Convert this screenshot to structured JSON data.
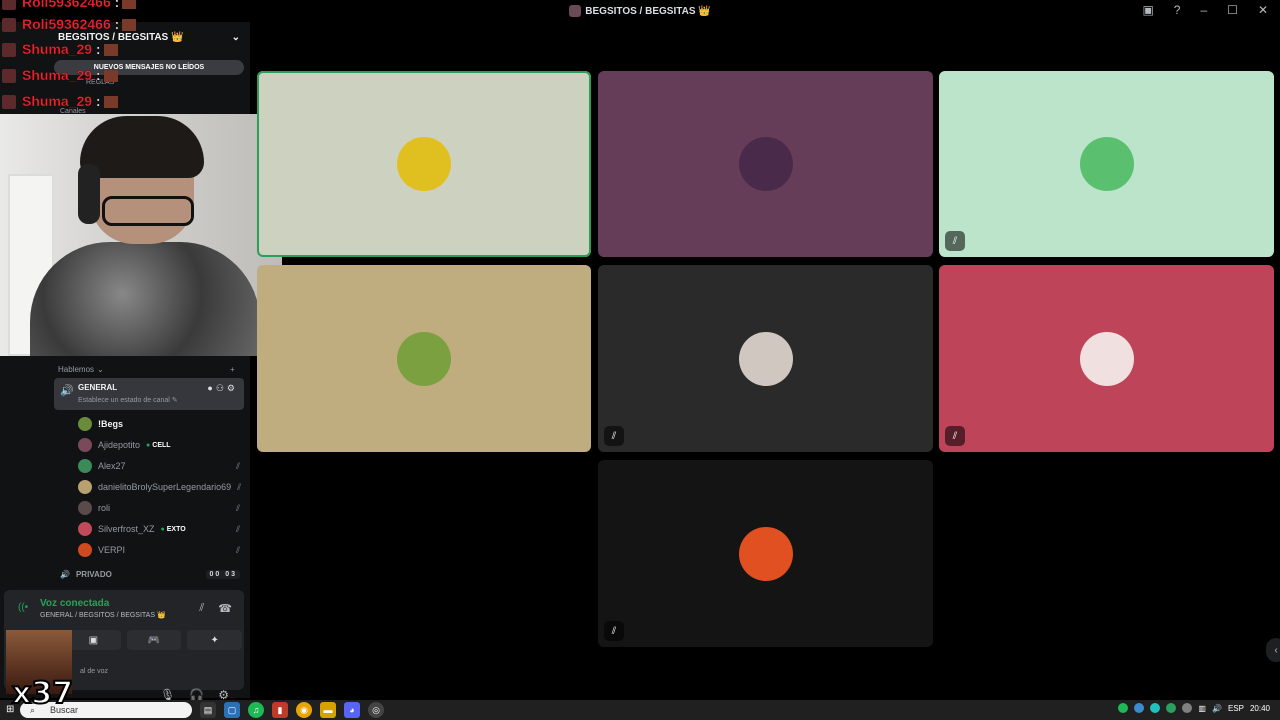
{
  "window": {
    "title": "BEGSITOS / BEGSITAS 👑"
  },
  "server": {
    "name": "BEGSITOS / BEGSITAS 👑",
    "unread_pill": "NUEVOS MENSAJES NO LEÍDOS",
    "channel_fragment": "REGLAS",
    "category_top": "Canales"
  },
  "stream_chat": [
    {
      "user": "Roli59362466",
      "sep": " :"
    },
    {
      "user": "Roli59362466",
      "sep": " :"
    },
    {
      "user": "Shuma_29",
      "sep": " :"
    },
    {
      "user": "Shuma_29",
      "sep": " :"
    },
    {
      "user": "Shuma_29",
      "sep": " :"
    }
  ],
  "category": {
    "name": "Hablemos"
  },
  "voice_channel": {
    "name": "GENERAL",
    "status_placeholder": "Establece un estado de canal"
  },
  "members": [
    {
      "name": "!Begs",
      "active": true,
      "badge": "",
      "color": "#6a8c3a",
      "muted": false
    },
    {
      "name": "Ajidepotito",
      "active": false,
      "badge": "CELL",
      "color": "#7a4a5a",
      "muted": false
    },
    {
      "name": "Alex27",
      "active": false,
      "badge": "",
      "color": "#3a8a5a",
      "muted": true
    },
    {
      "name": "danielitoBrolySuperLegendario69",
      "active": false,
      "badge": "",
      "color": "#b8a070",
      "muted": true
    },
    {
      "name": "roli",
      "active": false,
      "badge": "",
      "color": "#5a4a4a",
      "muted": true
    },
    {
      "name": "Silverfrost_XZ",
      "active": false,
      "badge": "EXTO",
      "color": "#c04a5a",
      "muted": true
    },
    {
      "name": "VERPI",
      "active": false,
      "badge": "",
      "color": "#d04a20",
      "muted": true
    }
  ],
  "private_channel": {
    "name": "PRIVADO",
    "count": "00 03"
  },
  "voice_panel": {
    "status": "Voz conectada",
    "location": "GENERAL / BEGSITOS / BEGSITAS 👑",
    "bottom_text": "al de voz"
  },
  "overlay": {
    "emote_count": "x37"
  },
  "tiles": [
    {
      "bg": "#cdd1c0",
      "avatar": "#e0c020",
      "speaking": true,
      "muted": false
    },
    {
      "bg": "#653d59",
      "avatar": "#4a2a4a",
      "speaking": false,
      "muted": false
    },
    {
      "bg": "#bbe4cb",
      "avatar": "#5ac070",
      "speaking": false,
      "muted": true
    },
    {
      "bg": "#bfad7f",
      "avatar": "#7aa040",
      "speaking": false,
      "muted": false
    },
    {
      "bg": "#2b2a2a",
      "avatar": "#d0c8c0",
      "speaking": false,
      "muted": true
    },
    {
      "bg": "#be4459",
      "avatar": "#f0e0e0",
      "speaking": false,
      "muted": true
    },
    {
      "bg": "#141414",
      "avatar": "#e05020",
      "speaking": false,
      "muted": true
    }
  ],
  "taskbar": {
    "search_placeholder": "Buscar",
    "lang": "ESP",
    "time": "20:40"
  },
  "icons": {
    "mute": "mic-off-icon",
    "deafen": "headphones-icon",
    "settings": "gear-icon",
    "help": "help-icon",
    "inbox": "inbox-icon"
  }
}
